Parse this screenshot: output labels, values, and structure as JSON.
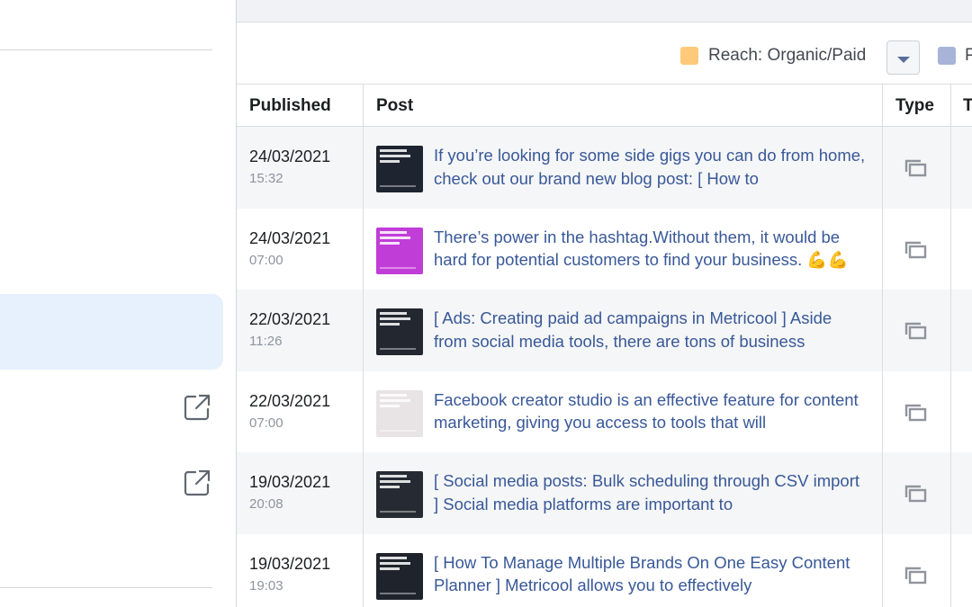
{
  "legend": {
    "items": [
      {
        "label": "Reach: Organic/Paid",
        "color": "#ffc97a"
      },
      {
        "label": "P",
        "color": "#a7b4d8"
      }
    ]
  },
  "table": {
    "headers": {
      "published": "Published",
      "post": "Post",
      "type": "Type",
      "extra": "T"
    },
    "rows": [
      {
        "date": "24/03/2021",
        "time": "15:32",
        "text": "If you’re looking for some side gigs you can do from home, check out our brand new blog post: [ How to",
        "thumb_color": "#1e2430",
        "type_icon": "multi-photo-icon"
      },
      {
        "date": "24/03/2021",
        "time": "07:00",
        "text": "There’s power in the hashtag.Without them, it would be hard for potential customers to find your business. 💪💪",
        "thumb_color": "#c13dd8",
        "type_icon": "multi-photo-icon"
      },
      {
        "date": "22/03/2021",
        "time": "11:26",
        "text": "[ Ads: Creating paid ad campaigns in Metricool ] Aside from social media tools, there are tons of business",
        "thumb_color": "#232830",
        "type_icon": "multi-photo-icon"
      },
      {
        "date": "22/03/2021",
        "time": "07:00",
        "text": "Facebook creator studio is an effective feature for content marketing, giving you access to tools that will",
        "thumb_color": "#e8e4e6",
        "type_icon": "multi-photo-icon"
      },
      {
        "date": "19/03/2021",
        "time": "20:08",
        "text": "[ Social media posts: Bulk scheduling through CSV import ] Social media platforms are important to",
        "thumb_color": "#262b33",
        "type_icon": "multi-photo-icon"
      },
      {
        "date": "19/03/2021",
        "time": "19:03",
        "text": "[ How To Manage Multiple Brands On One Easy Content Planner ] Metricool allows you to effectively",
        "thumb_color": "#1f242c",
        "type_icon": "multi-photo-icon"
      }
    ]
  },
  "sidebar": {
    "icons": [
      "external-link-icon",
      "external-link-icon"
    ]
  }
}
